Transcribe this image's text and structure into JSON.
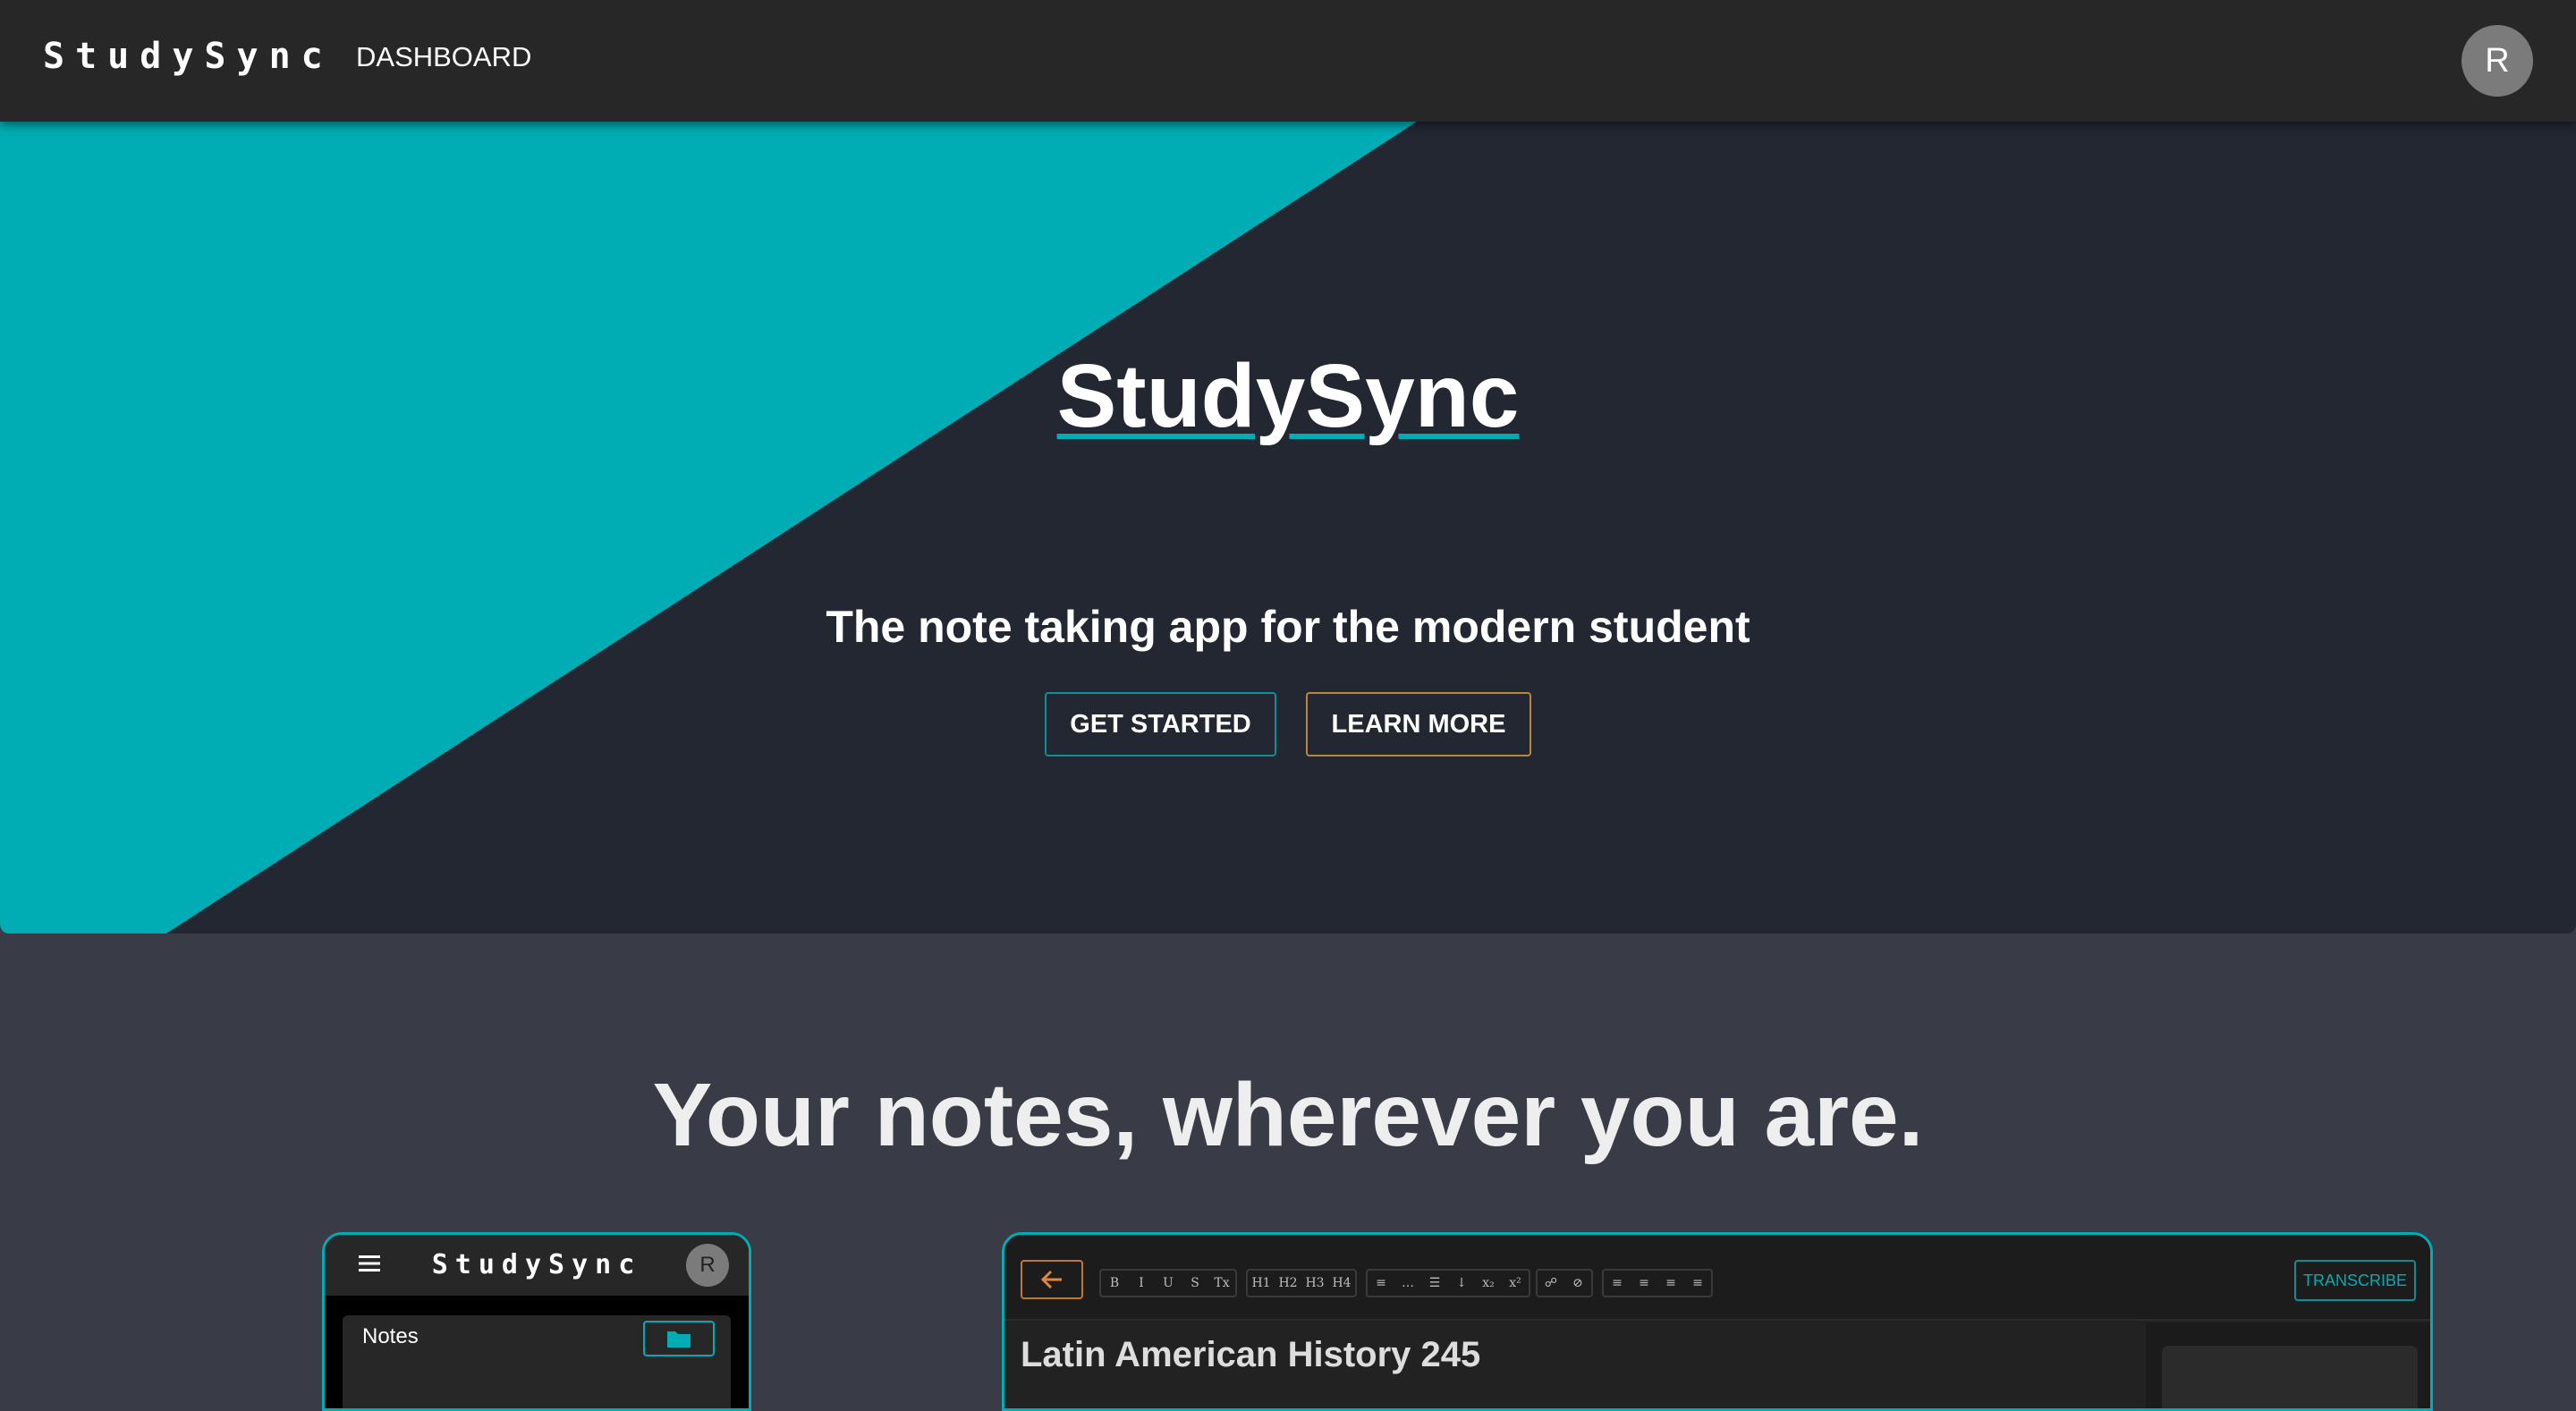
{
  "appbar": {
    "brand": "StudySync",
    "nav_dashboard": "DASHBOARD",
    "avatar_initial": "R"
  },
  "hero": {
    "title": "StudySync",
    "subtitle": "The note taking app for the modern student",
    "get_started_label": "GET STARTED",
    "learn_more_label": "LEARN MORE"
  },
  "section": {
    "heading": "Your notes, wherever you are."
  },
  "mobile_preview": {
    "menu_icon": "hamburger-icon",
    "brand": "StudySync",
    "avatar_initial": "R",
    "notes_label": "Notes",
    "folder_icon": "new-folder-icon"
  },
  "desktop_preview": {
    "back_icon": "arrow-left-icon",
    "format_tools": [
      "B",
      "I",
      "U",
      "S",
      "Tx"
    ],
    "heading_tools": [
      "H1",
      "H2",
      "H3",
      "H4"
    ],
    "list_tools": [
      "≡",
      "…",
      "☰",
      "↓",
      "x₂",
      "x²"
    ],
    "link_tools": [
      "☍",
      "⊘"
    ],
    "align_tools": [
      "≡",
      "≡",
      "≡",
      "≡"
    ],
    "transcribe_label": "TRANSCRIBE",
    "note_title": "Latin American History 245"
  },
  "colors": {
    "accent_teal": "#00adb5",
    "accent_orange": "#c0772f",
    "appbar_bg": "#272727",
    "hero_bg": "#222732",
    "page_bg": "#393c46"
  }
}
